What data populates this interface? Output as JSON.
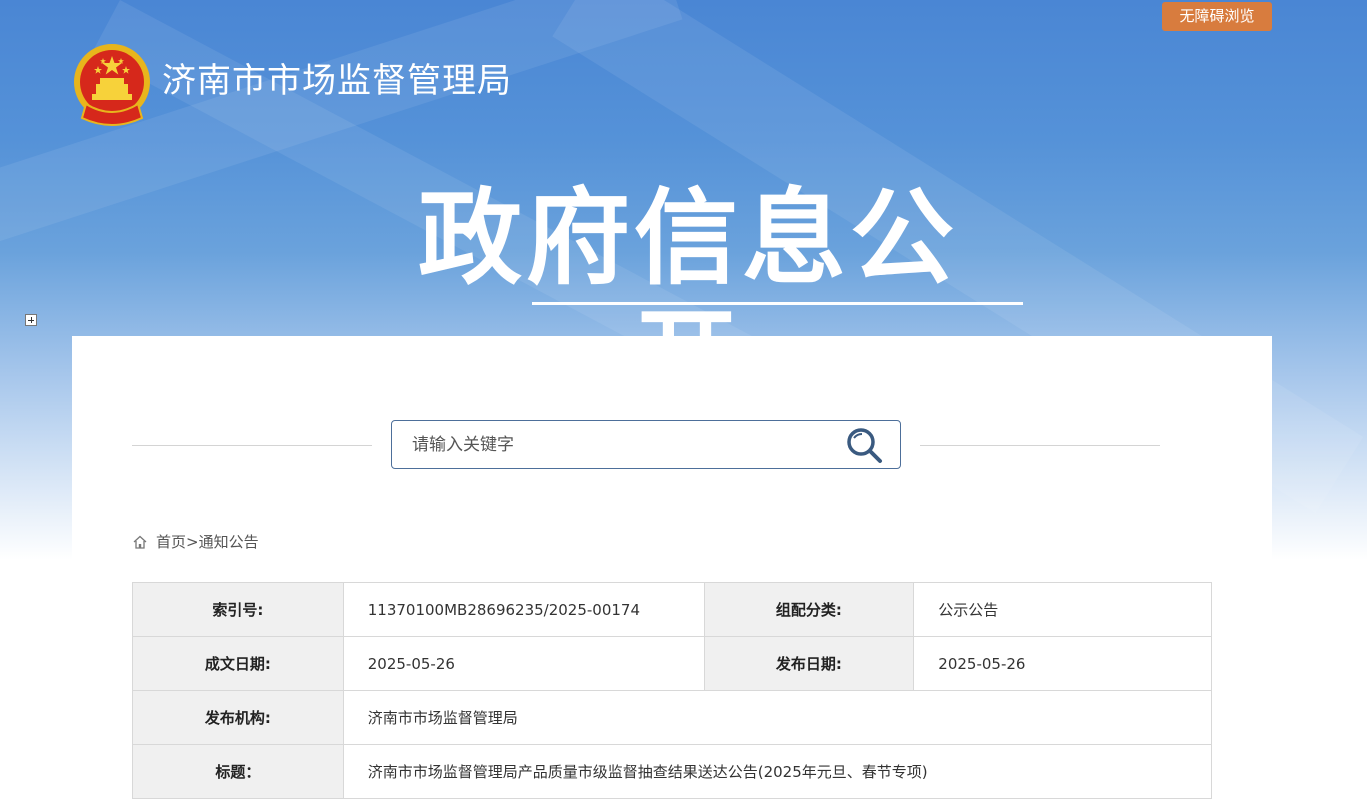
{
  "header": {
    "accessibility_label": "无障碍浏览",
    "site_title": "济南市市场监督管理局",
    "hero_title": "政府信息公开"
  },
  "search": {
    "placeholder": "请输入关键字"
  },
  "breadcrumb": {
    "home": "首页",
    "separator": ">",
    "current": "通知公告"
  },
  "info": {
    "index_no_label": "索引号:",
    "index_no_value": "11370100MB28696235/2025-00174",
    "category_label": "组配分类:",
    "category_value": "公示公告",
    "written_date_label": "成文日期:",
    "written_date_value": "2025-05-26",
    "publish_date_label": "发布日期:",
    "publish_date_value": "2025-05-26",
    "publisher_label": "发布机构:",
    "publisher_value": "济南市市场监督管理局",
    "title_label": "标题：",
    "title_value": "济南市市场监督管理局产品质量市级监督抽查结果送达公告(2025年元旦、春节专项)"
  },
  "icons": {
    "emblem": "national-emblem",
    "search": "magnifier-icon",
    "home": "home-icon",
    "expand": "expand-icon"
  },
  "colors": {
    "banner_blue": "#4a86d4",
    "access_orange": "#d87c3e",
    "search_border": "#4d6f9a",
    "label_bg": "#f0f0f0"
  }
}
